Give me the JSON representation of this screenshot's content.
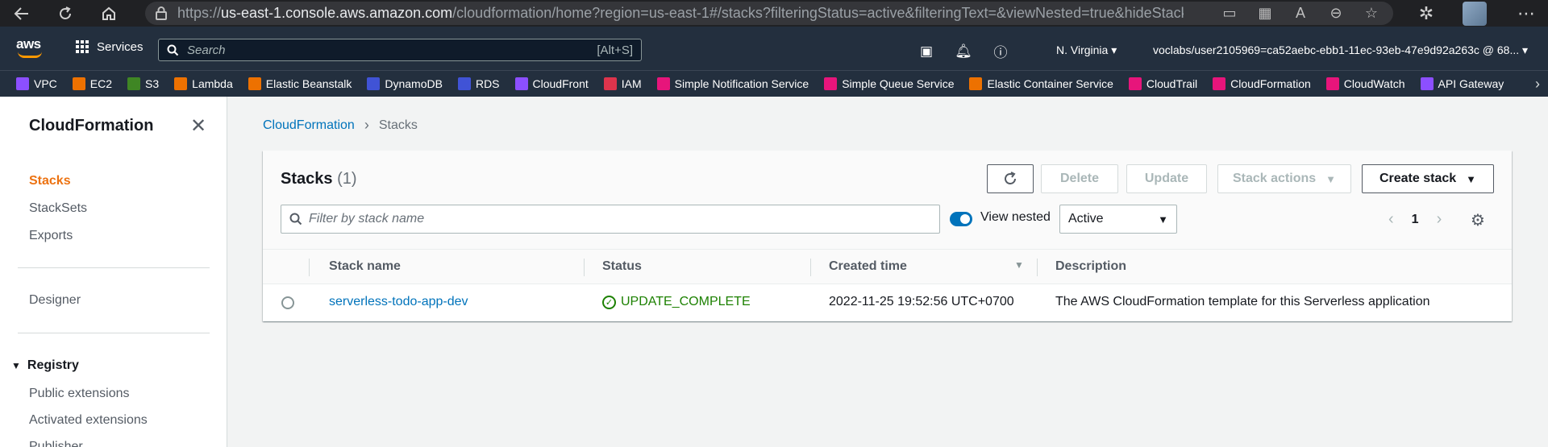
{
  "browser": {
    "url_prefix": "https://",
    "url_host": "us-east-1.console.aws.amazon.com",
    "url_rest": "/cloudformation/home?region=us-east-1#/stacks?filteringStatus=active&filteringText=&viewNested=true&hideStacks..."
  },
  "aws_nav": {
    "services_label": "Services",
    "search_placeholder": "Search",
    "search_shortcut": "[Alt+S]",
    "region": "N. Virginia ▾",
    "account": "voclabs/user2105969=ca52aebc-ebb1-11ec-93eb-47e9d92a263c @ 68... ▾"
  },
  "service_bar": [
    {
      "label": "VPC",
      "color": "#8c4fff"
    },
    {
      "label": "EC2",
      "color": "#ed7100"
    },
    {
      "label": "S3",
      "color": "#3f8624"
    },
    {
      "label": "Lambda",
      "color": "#ed7100"
    },
    {
      "label": "Elastic Beanstalk",
      "color": "#ed7100"
    },
    {
      "label": "DynamoDB",
      "color": "#4053d6"
    },
    {
      "label": "RDS",
      "color": "#4053d6"
    },
    {
      "label": "CloudFront",
      "color": "#8c4fff"
    },
    {
      "label": "IAM",
      "color": "#dd344c"
    },
    {
      "label": "Simple Notification Service",
      "color": "#e7157b"
    },
    {
      "label": "Simple Queue Service",
      "color": "#e7157b"
    },
    {
      "label": "Elastic Container Service",
      "color": "#ed7100"
    },
    {
      "label": "CloudTrail",
      "color": "#e7157b"
    },
    {
      "label": "CloudFormation",
      "color": "#e7157b"
    },
    {
      "label": "CloudWatch",
      "color": "#e7157b"
    },
    {
      "label": "API Gateway",
      "color": "#8c4fff"
    }
  ],
  "sidebar": {
    "title": "CloudFormation",
    "items": [
      "Stacks",
      "StackSets",
      "Exports"
    ],
    "designer": "Designer",
    "registry_heading": "Registry",
    "registry_items": [
      "Public extensions",
      "Activated extensions",
      "Publisher"
    ]
  },
  "breadcrumb": {
    "root": "CloudFormation",
    "current": "Stacks"
  },
  "panel": {
    "title": "Stacks",
    "count": "(1)",
    "buttons": {
      "delete": "Delete",
      "update": "Update",
      "stack_actions": "Stack actions",
      "create": "Create stack"
    },
    "filter_placeholder": "Filter by stack name",
    "view_nested_label": "View nested",
    "status_filter": "Active",
    "page": "1",
    "columns": [
      "Stack name",
      "Status",
      "Created time",
      "Description"
    ],
    "rows": [
      {
        "name": "serverless-todo-app-dev",
        "status": "UPDATE_COMPLETE",
        "created": "2022-11-25 19:52:56 UTC+0700",
        "description": "The AWS CloudFormation template for this Serverless application"
      }
    ]
  },
  "colors": {
    "accent": "#ec7211",
    "link": "#0073bb",
    "success": "#1d8102",
    "nav_bg": "#232f3e"
  }
}
